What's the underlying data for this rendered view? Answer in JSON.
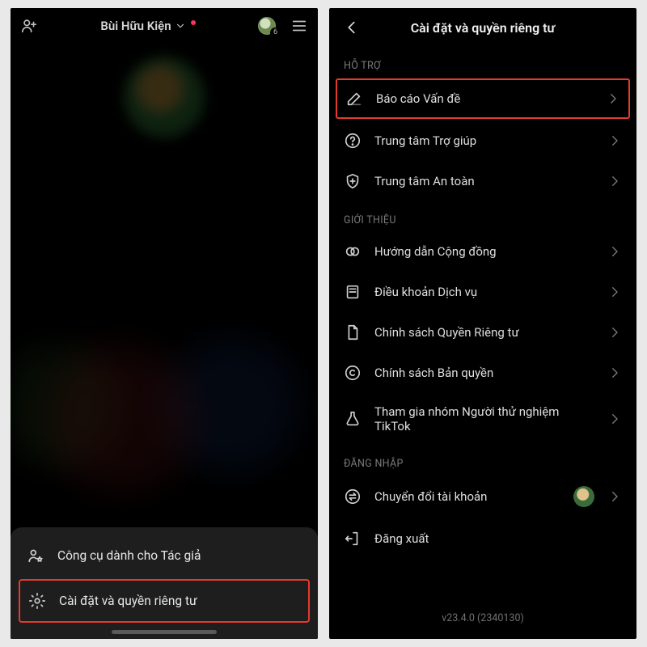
{
  "left_phone": {
    "header": {
      "display_name": "Bùi Hữu Kiện",
      "coin_badge": "6"
    },
    "bottom_sheet": {
      "item_creator_tools": "Công cụ dành cho Tác giả",
      "item_settings_privacy": "Cài đặt và quyền riêng tư"
    }
  },
  "right_phone": {
    "header_title": "Cài đặt và quyền riêng tư",
    "sections": {
      "support_title": "HỖ TRỢ",
      "about_title": "GIỚI THIỆU",
      "login_title": "ĐĂNG NHẬP"
    },
    "rows": {
      "report_problem": "Báo cáo Vấn đề",
      "help_center": "Trung tâm Trợ giúp",
      "safety_center": "Trung tâm An toàn",
      "community_guidelines": "Hướng dẫn Cộng đồng",
      "terms_of_service": "Điều khoản Dịch vụ",
      "privacy_policy": "Chính sách Quyền Riêng tư",
      "copyright_policy": "Chính sách Bản quyền",
      "join_beta": "Tham gia nhóm Người thử nghiệm TikTok",
      "switch_account": "Chuyển đổi tài khoản",
      "log_out": "Đăng xuất"
    },
    "version": "v23.4.0 (2340130)"
  }
}
